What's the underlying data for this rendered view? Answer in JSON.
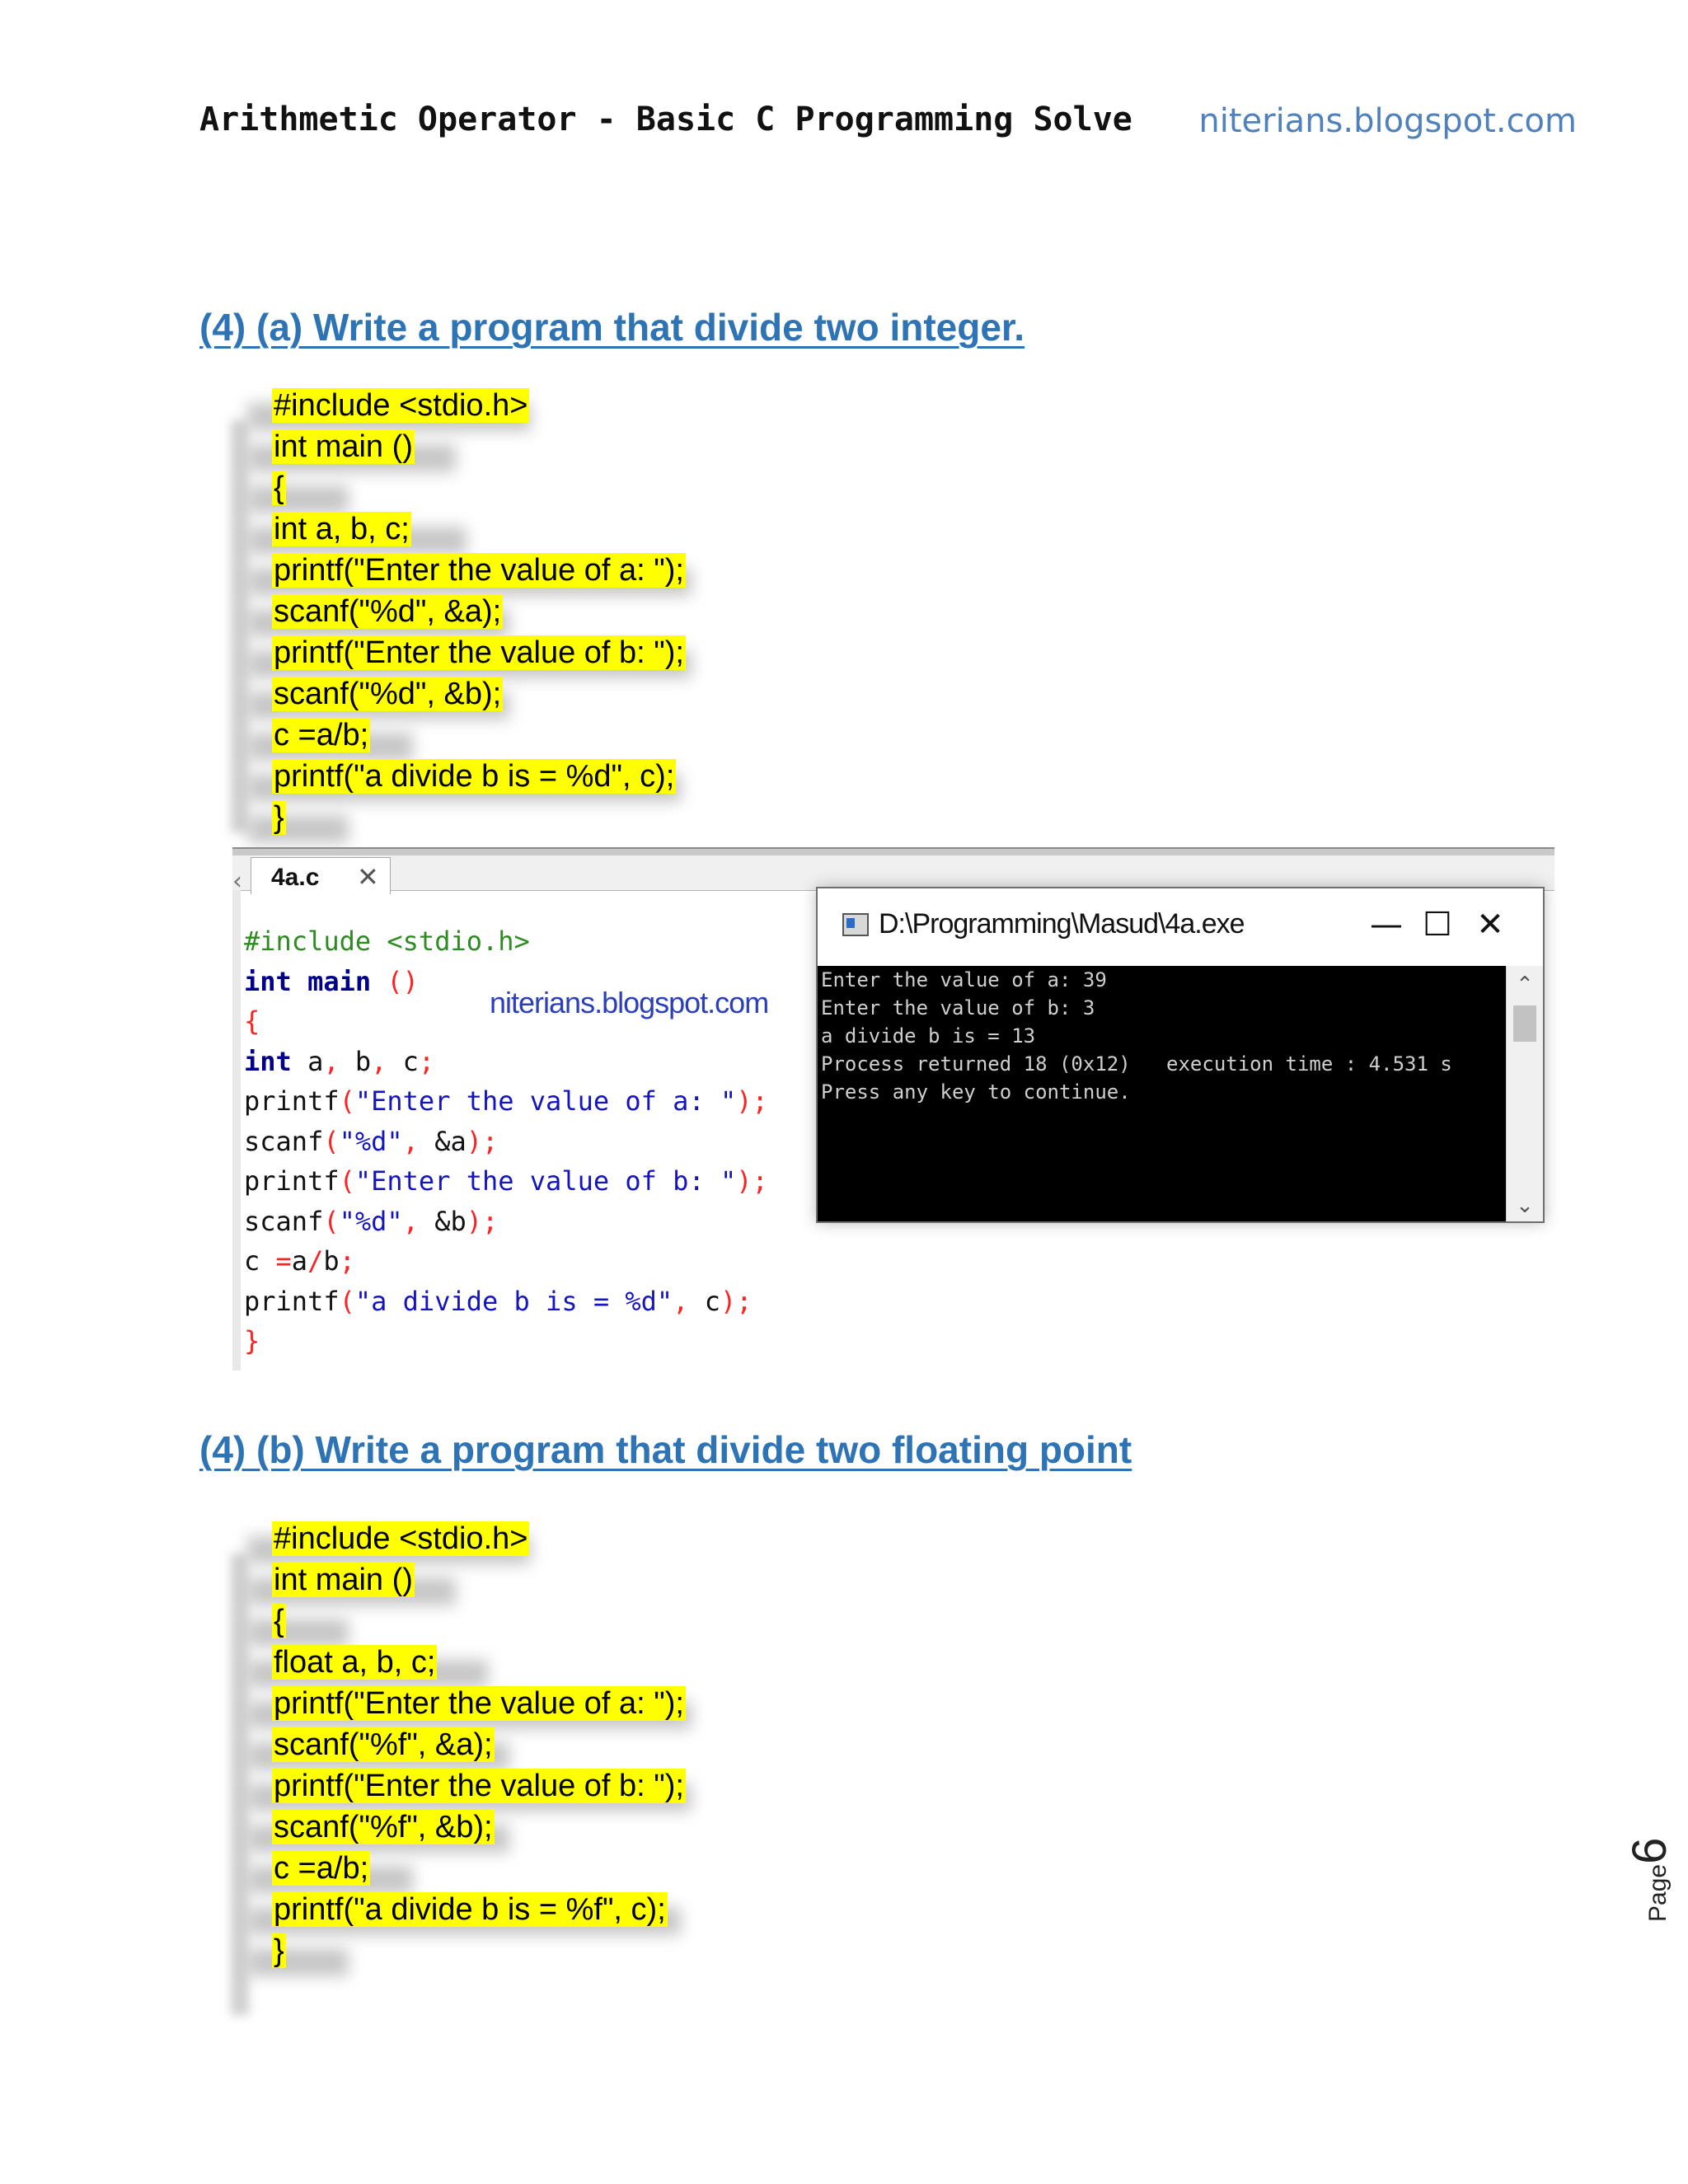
{
  "header": {
    "title": "Arithmetic Operator - Basic C Programming Solve",
    "site": "niterians.blogspot.com"
  },
  "section_a": {
    "heading": "(4) (a) Write a program that divide two integer.",
    "code": [
      "#include <stdio.h>",
      "int main ()",
      "{",
      "int a, b, c;",
      "printf(\"Enter the value of a: \");",
      "scanf(\"%d\", &a);",
      "printf(\"Enter the value of b: \");",
      "scanf(\"%d\", &b);",
      "c =a/b;",
      "printf(\"a divide b is = %d\", c);",
      "}"
    ]
  },
  "ide": {
    "tab_label": "4a.c",
    "watermark": "niterians.blogspot.com",
    "code_tokens": [
      [
        "#include <stdio.h>"
      ],
      [
        "int",
        " main ",
        "()"
      ],
      [
        "{"
      ],
      [
        "int",
        " a",
        ",",
        " b",
        ",",
        " c",
        ";"
      ],
      [
        "printf",
        "(",
        "\"Enter the value of a: \"",
        ");"
      ],
      [
        "scanf",
        "(",
        "\"%d\"",
        ",",
        " &a",
        ");"
      ],
      [
        "printf",
        "(",
        "\"Enter the value of b: \"",
        ");"
      ],
      [
        "scanf",
        "(",
        "\"%d\"",
        ",",
        " &b",
        ");"
      ],
      [
        "c ",
        "=",
        "a",
        "/",
        "b",
        ";"
      ],
      [
        "printf",
        "(",
        "\"a divide b is = %d\"",
        ",",
        " c",
        ");"
      ],
      [
        "}"
      ]
    ]
  },
  "console": {
    "title": "D:\\Programming\\Masud\\4a.exe",
    "minimize_symbol": "—",
    "maximize_symbol": "☐",
    "close_symbol": "✕",
    "output": [
      "Enter the value of a: 39",
      "Enter the value of b: 3",
      "a divide b is = 13",
      "Process returned 18 (0x12)   execution time : 4.531 s",
      "Press any key to continue."
    ]
  },
  "section_b": {
    "heading": "(4) (b) Write a program that divide two floating point",
    "code": [
      "#include <stdio.h>",
      "int main ()",
      "{",
      "float a, b, c;",
      "printf(\"Enter the value of a: \");",
      "scanf(\"%f\", &a);",
      "printf(\"Enter the value of b: \");",
      "scanf(\"%f\", &b);",
      "c =a/b;",
      "printf(\"a divide b is = %f\", c);",
      "}"
    ]
  },
  "footer": {
    "page_label": "Page",
    "page_number": "6"
  },
  "colors": {
    "heading": "#2e74b5",
    "highlight": "#ffff00",
    "site_link": "#4f81bd"
  }
}
